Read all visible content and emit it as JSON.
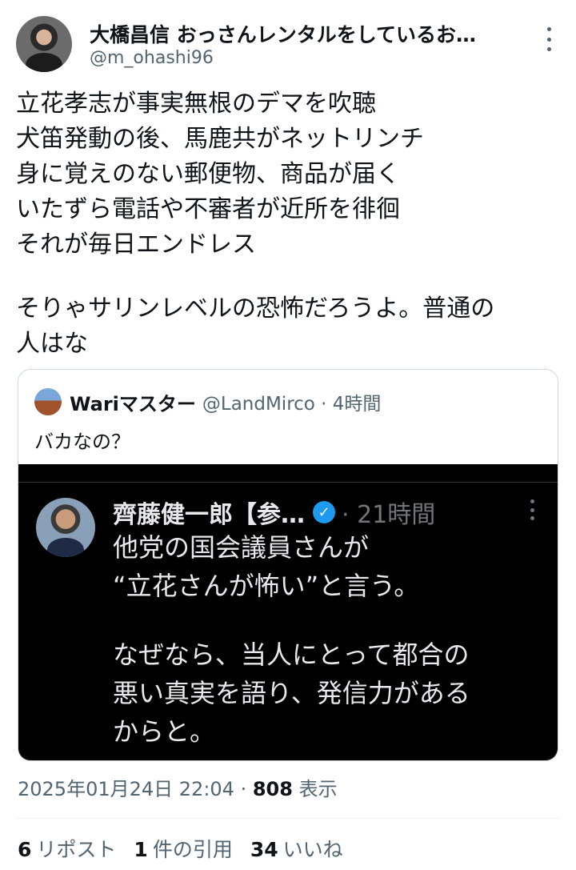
{
  "author": {
    "display_name": "大橋昌信 おっさんレンタルをしているお…",
    "handle": "@m_ohashi96"
  },
  "tweet": {
    "lines": [
      "立花孝志が事実無根のデマを吹聴",
      "犬笛発動の後、馬鹿共がネットリンチ",
      "身に覚えのない郵便物、商品が届く",
      "いたずら電話や不審者が近所を徘徊",
      "それが毎日エンドレス",
      "そりゃサリンレベルの恐怖だろうよ。普通の",
      "人はな"
    ]
  },
  "quote": {
    "name": "Wariマスター",
    "meta": "@LandMirco · 4時間",
    "text": "バカなの？",
    "inner": {
      "name": "齊藤健一郎【参…",
      "time": "· 21時間",
      "lines": [
        "他党の国会議員さんが",
        "“立花さんが怖い”と言う。",
        "なぜなら、当人にとって都合の",
        "悪い真実を語り、発信力がある",
        "からと。"
      ]
    }
  },
  "timestamp": "2025年01月24日 22:04 · ",
  "views": {
    "count": "808",
    "label": " 表示"
  },
  "stats": {
    "reposts": {
      "count": "6",
      "label": "リポスト"
    },
    "quotes": {
      "count": "1",
      "label": "件の引用"
    },
    "likes": {
      "count": "34",
      "label": "いいね"
    }
  }
}
